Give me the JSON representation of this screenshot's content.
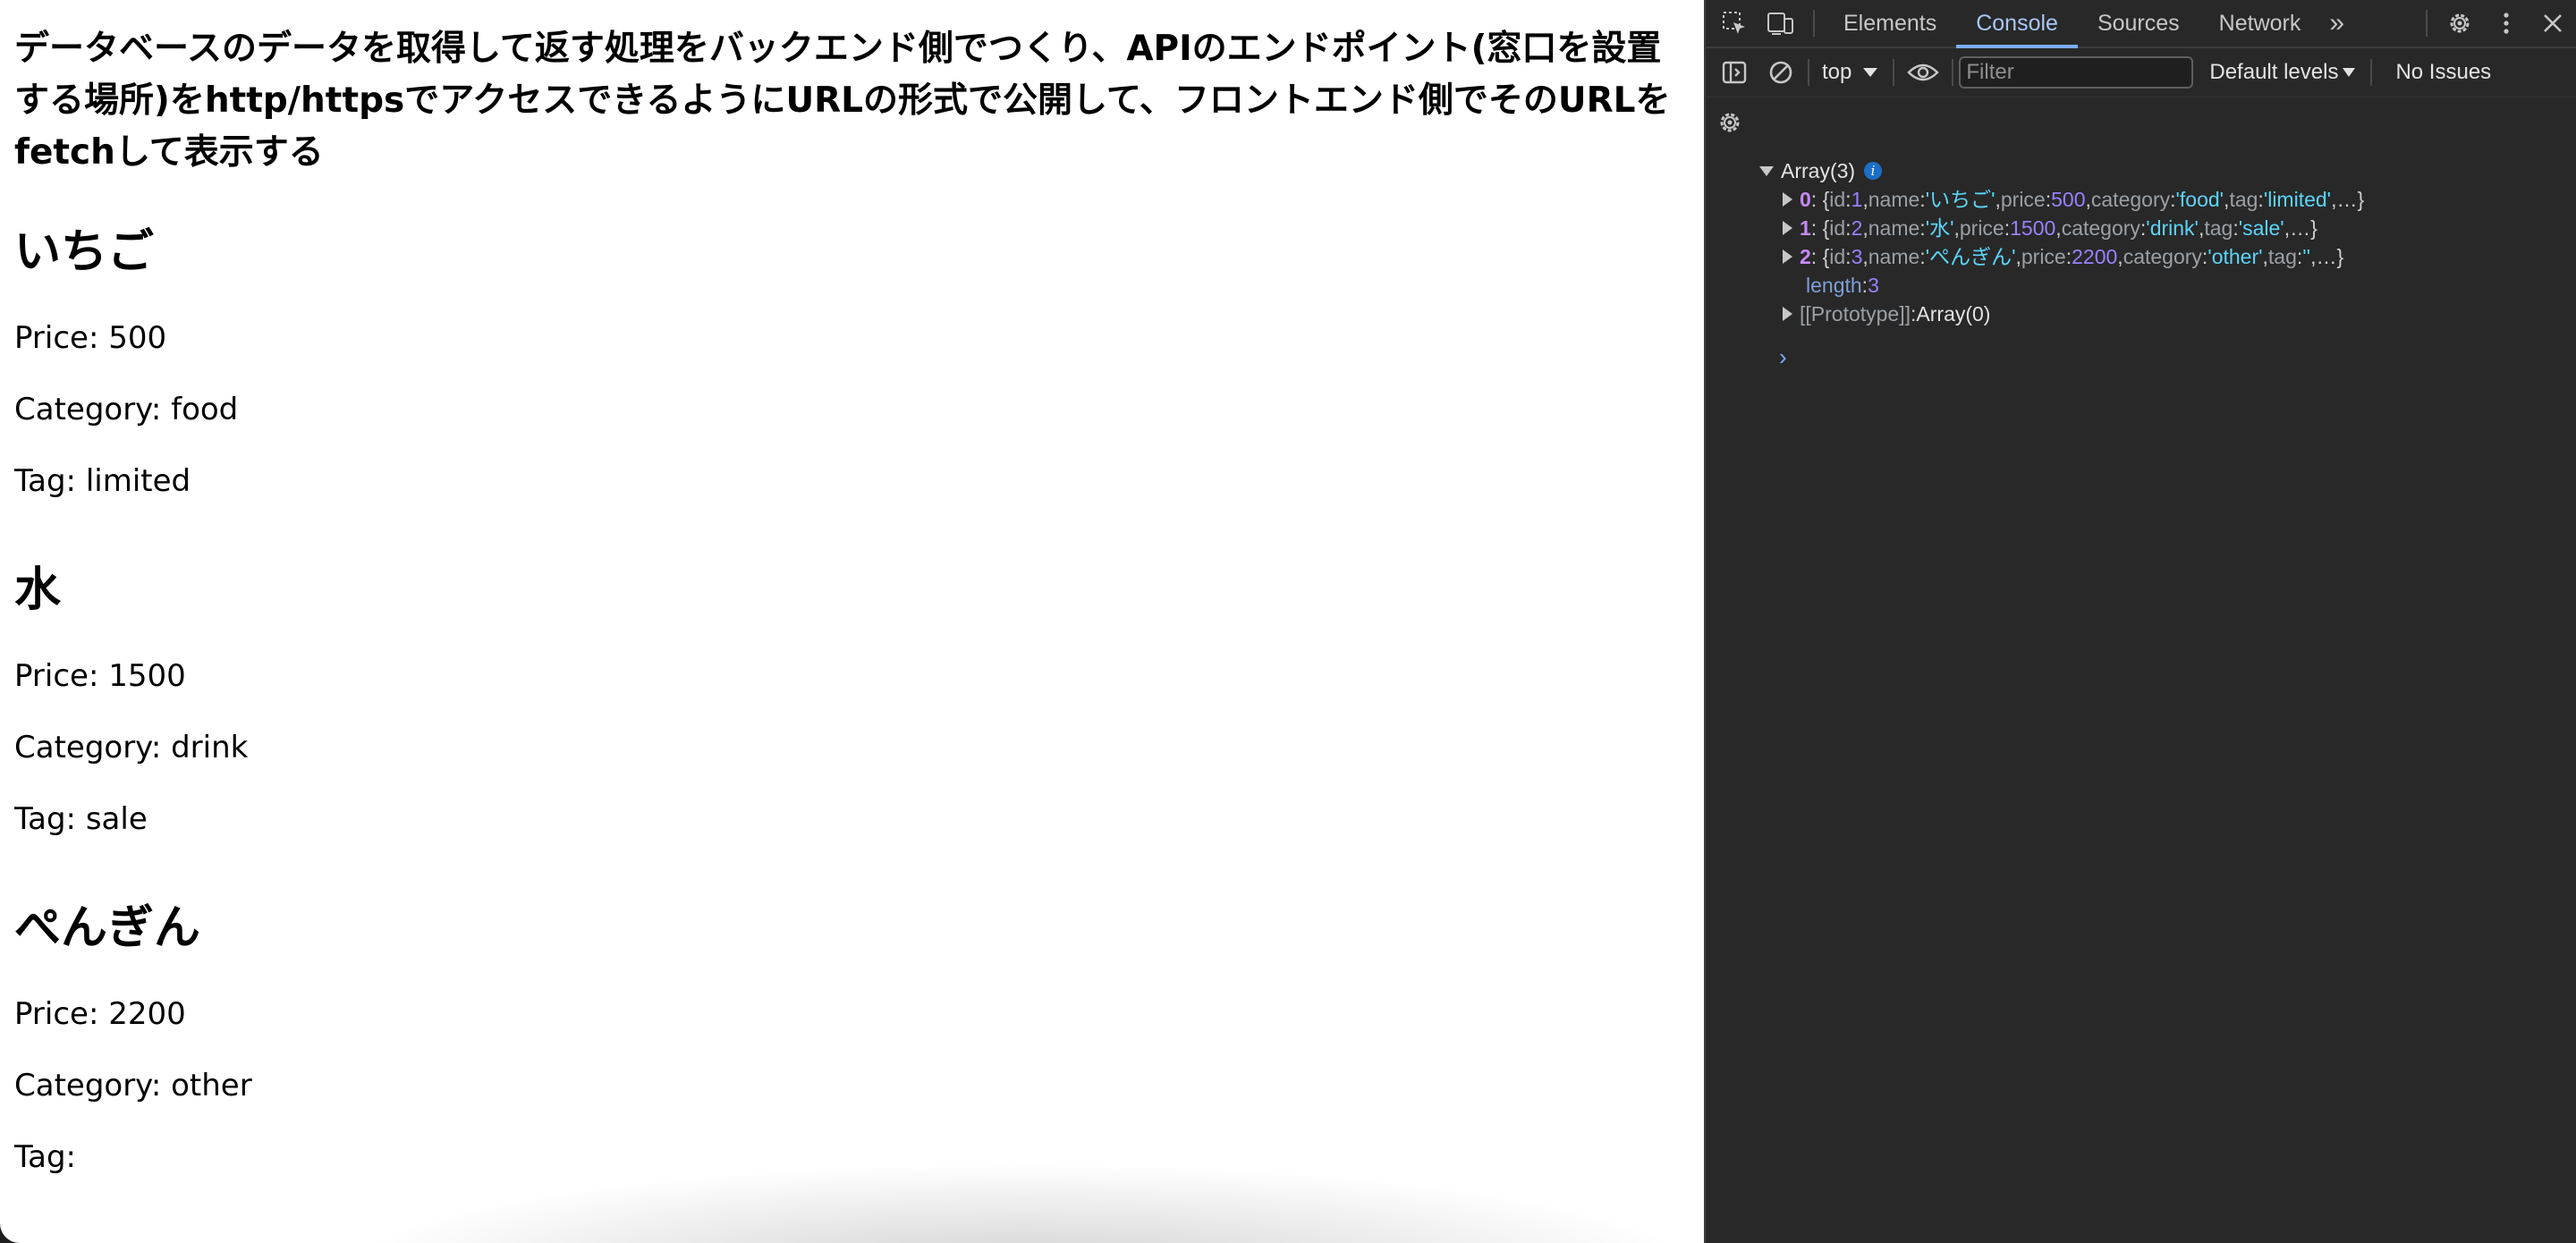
{
  "page": {
    "heading": "データベースのデータを取得して返す処理をバックエンド側でつくり、APIのエンドポイント(窓口を設置する場所)をhttp/httpsでアクセスできるようにURLの形式で公開して、フロントエンド側でそのURLをfetchして表示する",
    "items": [
      {
        "name": "いちご",
        "price": "Price: 500",
        "category": "Category: food",
        "tag": "Tag: limited"
      },
      {
        "name": "水",
        "price": "Price: 1500",
        "category": "Category: drink",
        "tag": "Tag: sale"
      },
      {
        "name": "ぺんぎん",
        "price": "Price: 2200",
        "category": "Category: other",
        "tag": "Tag:"
      }
    ]
  },
  "devtools": {
    "tabs": [
      "Elements",
      "Console",
      "Sources",
      "Network"
    ],
    "active_tab": "Console",
    "more_tabs": "»",
    "toolbar": {
      "context": "top",
      "filter_placeholder": "Filter",
      "levels": "Default levels",
      "issues": "No Issues"
    },
    "console": {
      "array_label": "Array(3)",
      "info_glyph": "i",
      "rows": [
        {
          "index": "0",
          "id": "1",
          "name": "'いちご'",
          "price": "500",
          "category": "'food'",
          "tag": "'limited'"
        },
        {
          "index": "1",
          "id": "2",
          "name": "'水'",
          "price": "1500",
          "category": "'drink'",
          "tag": "'sale'"
        },
        {
          "index": "2",
          "id": "3",
          "name": "'ぺんぎん'",
          "price": "2200",
          "category": "'other'",
          "tag": "''"
        }
      ],
      "keys": {
        "id": "id",
        "name": "name",
        "price": "price",
        "category": "category",
        "tag": "tag"
      },
      "ellipsis": "…",
      "length_key": "length",
      "length_value": "3",
      "proto_key": "[[Prototype]]",
      "proto_value": "Array(0)",
      "prompt": "›"
    }
  },
  "colors": {
    "devtools_bg": "#282828",
    "active_tab": "#a8c7fa",
    "string": "#5cd5fb",
    "number": "#9980ff",
    "prompt": "#7cacf8"
  }
}
